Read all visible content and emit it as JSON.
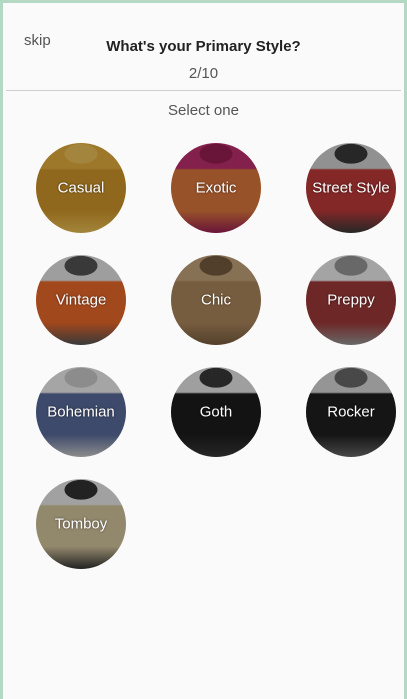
{
  "header": {
    "skip_label": "skip",
    "title": "What's your Primary Style?",
    "progress": "2/10"
  },
  "prompt": "Select one",
  "styles": [
    {
      "label": "Casual",
      "image": "yellow-dress-photo",
      "colors": [
        "#e9b23e",
        "#d49a2b",
        "#f0c55a"
      ]
    },
    {
      "label": "Exotic",
      "image": "pink-print-dress-photo",
      "colors": [
        "#c2306f",
        "#e07a3d",
        "#9b1f55"
      ]
    },
    {
      "label": "Street Style",
      "image": "red-top-photo",
      "colors": [
        "#d6d6d6",
        "#c23a3a",
        "#3a3a3a"
      ]
    },
    {
      "label": "Vintage",
      "image": "striped-top-orange-skirt-photo",
      "colors": [
        "#e9e9e9",
        "#ef6a2c",
        "#555555"
      ]
    },
    {
      "label": "Chic",
      "image": "trench-coat-photo",
      "colors": [
        "#c7a77e",
        "#b08a5e",
        "#7a5e40"
      ]
    },
    {
      "label": "Preppy",
      "image": "white-blouse-plaid-skirt-photo",
      "colors": [
        "#f2f2f2",
        "#a33a3a",
        "#9a9a9a"
      ]
    },
    {
      "label": "Bohemian",
      "image": "white-embroidered-top-photo",
      "colors": [
        "#f4f4f4",
        "#5a6d9e",
        "#cfcfcf"
      ]
    },
    {
      "label": "Goth",
      "image": "black-lace-dress-photo",
      "colors": [
        "#eaeaea",
        "#1c1c1c",
        "#3a3a3a"
      ]
    },
    {
      "label": "Rocker",
      "image": "graphic-tank-photo",
      "colors": [
        "#dcdcdc",
        "#1f1f1f",
        "#6a6a6a"
      ]
    },
    {
      "label": "Tomboy",
      "image": "graphic-tee-photo",
      "colors": [
        "#eeeeee",
        "#d8c9a0",
        "#333333"
      ]
    }
  ]
}
